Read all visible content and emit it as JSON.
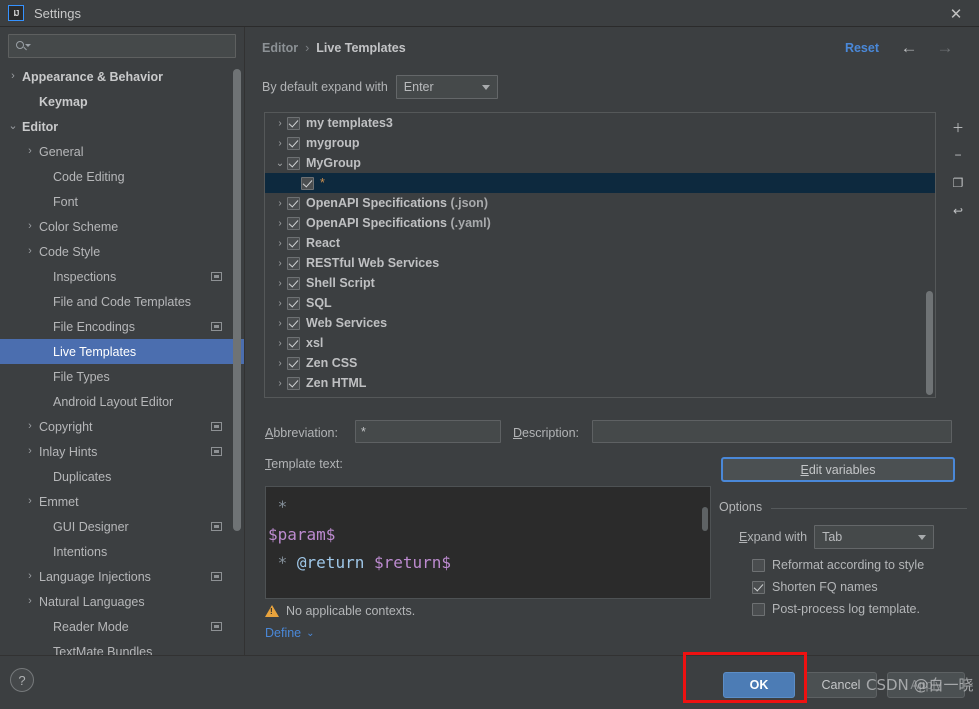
{
  "window": {
    "app_icon": "intellij-idea-logo",
    "title": "Settings",
    "close_label": "✕"
  },
  "sidebar": {
    "search": {
      "value": "",
      "placeholder": ""
    },
    "items": [
      {
        "label": "Appearance & Behavior",
        "arrow": "›",
        "indent": 10,
        "bold": true,
        "badge": false,
        "selected": false
      },
      {
        "label": "Keymap",
        "arrow": "",
        "indent": 27,
        "bold": true,
        "badge": false,
        "selected": false
      },
      {
        "label": "Editor",
        "arrow": "⌄",
        "indent": 10,
        "bold": true,
        "badge": false,
        "selected": false
      },
      {
        "label": "General",
        "arrow": "›",
        "indent": 27,
        "bold": false,
        "badge": false,
        "selected": false
      },
      {
        "label": "Code Editing",
        "arrow": "",
        "indent": 41,
        "bold": false,
        "badge": false,
        "selected": false
      },
      {
        "label": "Font",
        "arrow": "",
        "indent": 41,
        "bold": false,
        "badge": false,
        "selected": false
      },
      {
        "label": "Color Scheme",
        "arrow": "›",
        "indent": 27,
        "bold": false,
        "badge": false,
        "selected": false
      },
      {
        "label": "Code Style",
        "arrow": "›",
        "indent": 27,
        "bold": false,
        "badge": false,
        "selected": false
      },
      {
        "label": "Inspections",
        "arrow": "",
        "indent": 41,
        "bold": false,
        "badge": true,
        "selected": false
      },
      {
        "label": "File and Code Templates",
        "arrow": "",
        "indent": 41,
        "bold": false,
        "badge": false,
        "selected": false
      },
      {
        "label": "File Encodings",
        "arrow": "",
        "indent": 41,
        "bold": false,
        "badge": true,
        "selected": false
      },
      {
        "label": "Live Templates",
        "arrow": "",
        "indent": 41,
        "bold": false,
        "badge": false,
        "selected": true
      },
      {
        "label": "File Types",
        "arrow": "",
        "indent": 41,
        "bold": false,
        "badge": false,
        "selected": false
      },
      {
        "label": "Android Layout Editor",
        "arrow": "",
        "indent": 41,
        "bold": false,
        "badge": false,
        "selected": false
      },
      {
        "label": "Copyright",
        "arrow": "›",
        "indent": 27,
        "bold": false,
        "badge": true,
        "selected": false
      },
      {
        "label": "Inlay Hints",
        "arrow": "›",
        "indent": 27,
        "bold": false,
        "badge": true,
        "selected": false
      },
      {
        "label": "Duplicates",
        "arrow": "",
        "indent": 41,
        "bold": false,
        "badge": false,
        "selected": false
      },
      {
        "label": "Emmet",
        "arrow": "›",
        "indent": 27,
        "bold": false,
        "badge": false,
        "selected": false
      },
      {
        "label": "GUI Designer",
        "arrow": "",
        "indent": 41,
        "bold": false,
        "badge": true,
        "selected": false
      },
      {
        "label": "Intentions",
        "arrow": "",
        "indent": 41,
        "bold": false,
        "badge": false,
        "selected": false
      },
      {
        "label": "Language Injections",
        "arrow": "›",
        "indent": 27,
        "bold": false,
        "badge": true,
        "selected": false
      },
      {
        "label": "Natural Languages",
        "arrow": "›",
        "indent": 27,
        "bold": false,
        "badge": false,
        "selected": false
      },
      {
        "label": "Reader Mode",
        "arrow": "",
        "indent": 41,
        "bold": false,
        "badge": true,
        "selected": false
      },
      {
        "label": "TextMate Bundles",
        "arrow": "",
        "indent": 41,
        "bold": false,
        "badge": false,
        "selected": false
      }
    ]
  },
  "header": {
    "breadcrumb_parent": "Editor",
    "breadcrumb_sep": "›",
    "breadcrumb_current": "Live Templates",
    "reset_label": "Reset",
    "back_arrow": "←",
    "forward_arrow": "→"
  },
  "expand_default": {
    "label": "By default expand with",
    "value": "Enter"
  },
  "templates_tree": {
    "rows": [
      {
        "arrow": "›",
        "checked": true,
        "name": "my templates3",
        "suffix": "",
        "child": false,
        "selected": false
      },
      {
        "arrow": "›",
        "checked": true,
        "name": "mygroup",
        "suffix": "",
        "child": false,
        "selected": false
      },
      {
        "arrow": "⌄",
        "checked": true,
        "name": "MyGroup",
        "suffix": "",
        "child": false,
        "selected": false
      },
      {
        "arrow": "",
        "checked": true,
        "name": "*",
        "suffix": "",
        "child": true,
        "selected": true
      },
      {
        "arrow": "›",
        "checked": true,
        "name": "OpenAPI Specifications",
        "suffix": " (.json)",
        "child": false,
        "selected": false
      },
      {
        "arrow": "›",
        "checked": true,
        "name": "OpenAPI Specifications",
        "suffix": " (.yaml)",
        "child": false,
        "selected": false
      },
      {
        "arrow": "›",
        "checked": true,
        "name": "React",
        "suffix": "",
        "child": false,
        "selected": false
      },
      {
        "arrow": "›",
        "checked": true,
        "name": "RESTful Web Services",
        "suffix": "",
        "child": false,
        "selected": false
      },
      {
        "arrow": "›",
        "checked": true,
        "name": "Shell Script",
        "suffix": "",
        "child": false,
        "selected": false
      },
      {
        "arrow": "›",
        "checked": true,
        "name": "SQL",
        "suffix": "",
        "child": false,
        "selected": false
      },
      {
        "arrow": "›",
        "checked": true,
        "name": "Web Services",
        "suffix": "",
        "child": false,
        "selected": false
      },
      {
        "arrow": "›",
        "checked": true,
        "name": "xsl",
        "suffix": "",
        "child": false,
        "selected": false
      },
      {
        "arrow": "›",
        "checked": true,
        "name": "Zen CSS",
        "suffix": "",
        "child": false,
        "selected": false
      },
      {
        "arrow": "›",
        "checked": true,
        "name": "Zen HTML",
        "suffix": "",
        "child": false,
        "selected": false
      }
    ],
    "tools": [
      {
        "icon": "add-icon",
        "glyph": "＋"
      },
      {
        "icon": "remove-icon",
        "glyph": "−"
      },
      {
        "icon": "copy-icon",
        "glyph": "❐"
      },
      {
        "icon": "revert-icon",
        "glyph": "↩"
      }
    ]
  },
  "fields": {
    "abbreviation_label": "Abbreviation:",
    "abbreviation_value": "*",
    "description_label": "Description:",
    "description_value": "",
    "template_text_label": "Template text:",
    "edit_variables_label": "Edit variables"
  },
  "code": {
    "line1": " *",
    "line2": "$param$",
    "line3_star": " * ",
    "line3_tag": "@return ",
    "line3_var": "$return$"
  },
  "options": {
    "title": "Options",
    "expand_with_label": "Expand with",
    "expand_with_value": "Tab",
    "checkboxes": [
      {
        "label": "Reformat according to style",
        "checked": false
      },
      {
        "label": "Shorten FQ names",
        "checked": true
      },
      {
        "label": "Post-process log template.",
        "checked": false
      }
    ]
  },
  "context": {
    "warning_text": "No applicable contexts.",
    "define_label": "Define",
    "define_chevron": "⌄"
  },
  "footer": {
    "help_label": "?",
    "ok_label": "OK",
    "cancel_label": "Cancel",
    "apply_label": "Apply"
  },
  "annotation": {
    "watermark": "CSDN @白一晓",
    "highlight_color": "#ee1111"
  }
}
